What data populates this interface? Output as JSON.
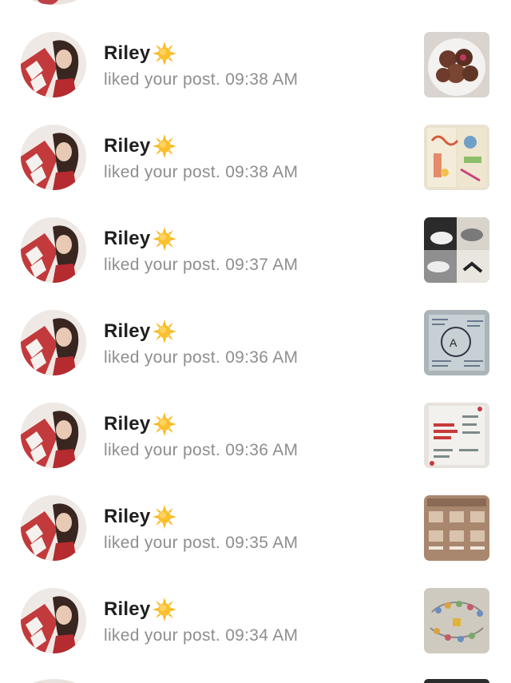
{
  "notifications": [
    {
      "user": "Riley",
      "emoji": "sun",
      "action": "liked your post.",
      "time": "09:38 AM",
      "thumb": "chocolate-truffles"
    },
    {
      "user": "Riley",
      "emoji": "sun",
      "action": "liked your post.",
      "time": "09:38 AM",
      "thumb": "colorful-notebook"
    },
    {
      "user": "Riley",
      "emoji": "sun",
      "action": "liked your post.",
      "time": "09:37 AM",
      "thumb": "sneakers-collage"
    },
    {
      "user": "Riley",
      "emoji": "sun",
      "action": "liked your post.",
      "time": "09:36 AM",
      "thumb": "study-notes"
    },
    {
      "user": "Riley",
      "emoji": "sun",
      "action": "liked your post.",
      "time": "09:36 AM",
      "thumb": "things-to-quit-2024"
    },
    {
      "user": "Riley",
      "emoji": "sun",
      "action": "liked your post.",
      "time": "09:35 AM",
      "thumb": "fill-notebook-ideas"
    },
    {
      "user": "Riley",
      "emoji": "sun",
      "action": "liked your post.",
      "time": "09:34 AM",
      "thumb": "charms-jewelry"
    }
  ],
  "colors": {
    "name": "#1f1f1f",
    "secondary_text": "#8e8e8e",
    "background": "#ffffff",
    "avatar_accent": "#b62b30"
  }
}
